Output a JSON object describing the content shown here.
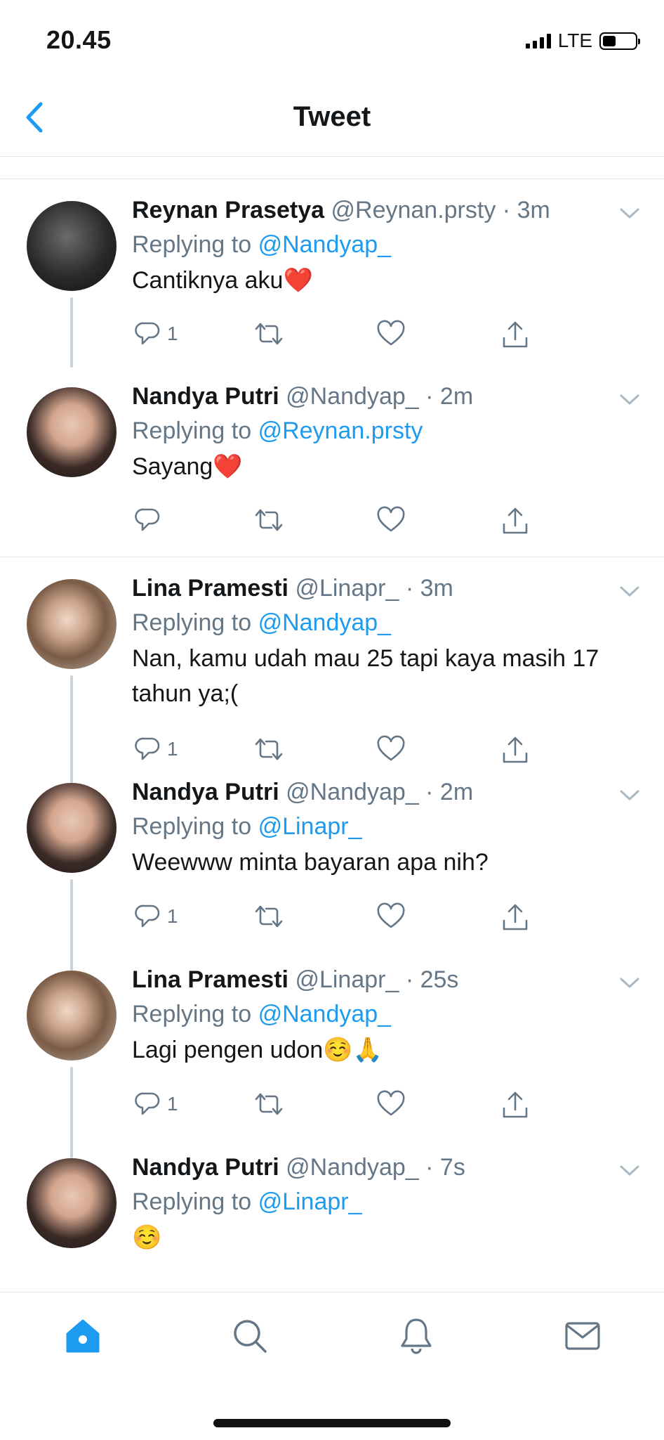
{
  "status": {
    "time": "20.45",
    "network": "LTE",
    "battery_level": 0.4
  },
  "header": {
    "title": "Tweet"
  },
  "colors": {
    "accent": "#1d9bf0",
    "muted": "#657786",
    "text": "#14171a",
    "thread": "#c9d3dc"
  },
  "replying_label": "Replying to",
  "tweets": [
    {
      "name": "Reynan Prasetya",
      "handle": "@Reynan.prsty",
      "time": "· 3m",
      "reply_to": "@Nandyap_",
      "text": "Cantiknya aku❤️",
      "reply_count": "1"
    },
    {
      "name": "Nandya Putri",
      "handle": "@Nandyap_",
      "time": "· 2m",
      "reply_to": "@Reynan.prsty",
      "text": "Sayang❤️",
      "reply_count": ""
    },
    {
      "name": "Lina Pramesti",
      "handle": "@Linapr_",
      "time": "· 3m",
      "reply_to": "@Nandyap_",
      "text": "Nan, kamu udah mau 25 tapi kaya masih 17 tahun ya;(",
      "reply_count": "1"
    },
    {
      "name": "Nandya Putri",
      "handle": "@Nandyap_",
      "time": "· 2m",
      "reply_to": "@Linapr_",
      "text": "Weewww minta bayaran apa nih?",
      "reply_count": "1"
    },
    {
      "name": "Lina Pramesti",
      "handle": "@Linapr_",
      "time": "· 25s",
      "reply_to": "@Nandyap_",
      "text": "Lagi pengen udon☺️🙏",
      "reply_count": "1"
    },
    {
      "name": "Nandya Putri",
      "handle": "@Nandyap_",
      "time": "· 7s",
      "reply_to": "@Linapr_",
      "text": "☺️",
      "reply_count": ""
    }
  ],
  "tabbar": {
    "items": [
      "home-icon",
      "search-icon",
      "notifications-icon",
      "messages-icon"
    ],
    "active": "home-icon"
  }
}
